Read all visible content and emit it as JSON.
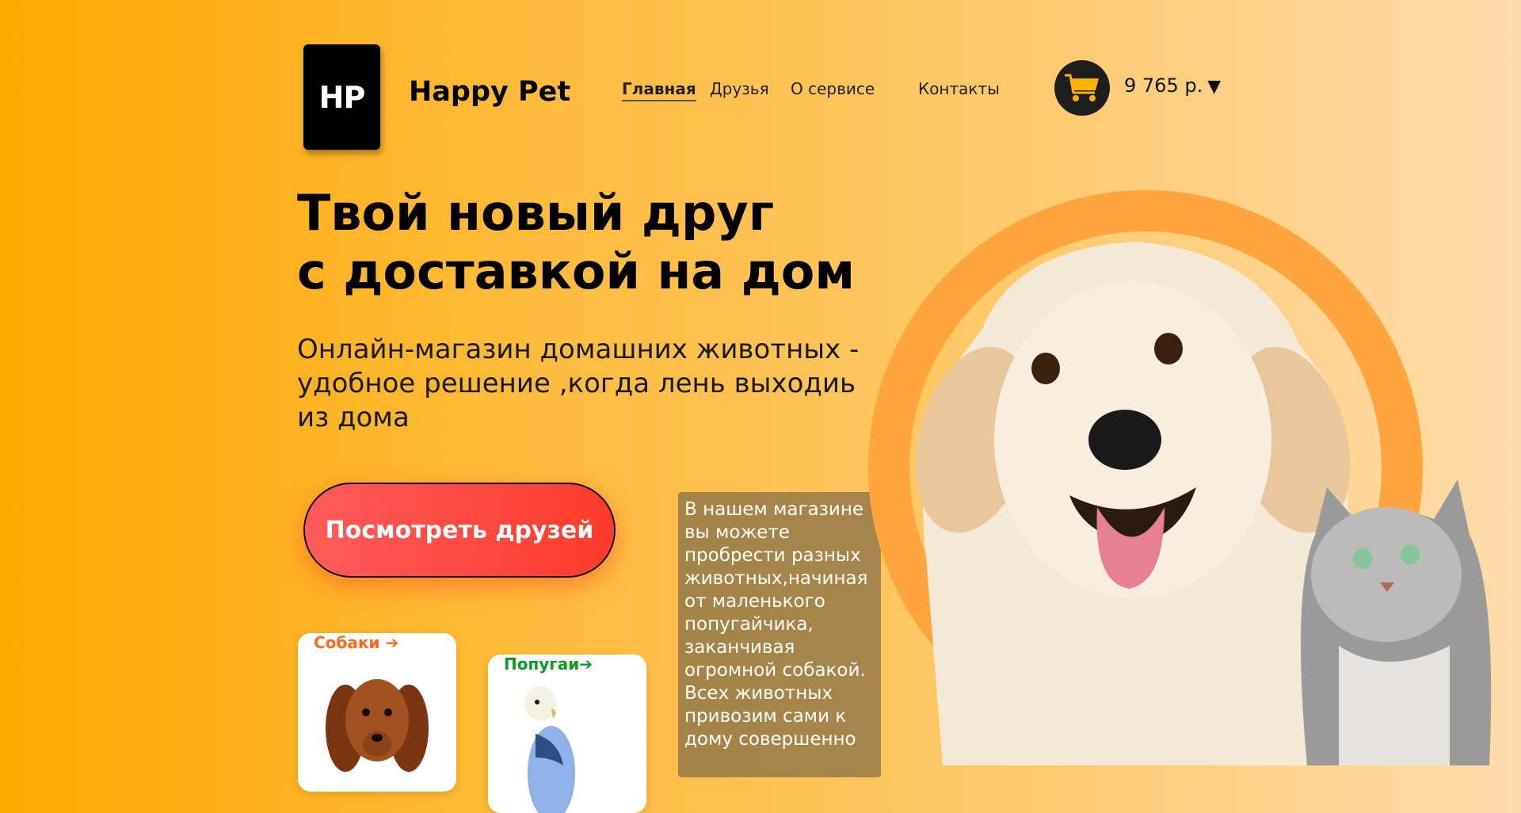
{
  "logo": {
    "text": "HP"
  },
  "brand": {
    "name": "Happy Pet"
  },
  "nav": {
    "items": [
      {
        "label": "Главная",
        "active": true
      },
      {
        "label": "Друзья",
        "active": false
      },
      {
        "label": "О сервисе",
        "active": false
      },
      {
        "label": "Контакты",
        "active": false
      }
    ]
  },
  "cart": {
    "icon": "cart-icon",
    "total": "9 765 р.",
    "caret": "▼"
  },
  "hero": {
    "title_line1": "Твой новый друг",
    "title_line2": "с доставкой на дом",
    "lead": "Онлайн-магазин домашних животных - удобное решение ,когда лень выходиь из дома",
    "cta": "Посмотреть друзей"
  },
  "categories": [
    {
      "label": "Собаки ➔",
      "image": "dachshund-photo",
      "color": "#ff6a1a"
    },
    {
      "label": "Попугаи➔",
      "image": "budgie-photo",
      "color": "#119922"
    }
  ],
  "info": {
    "text": "В нашем магазине вы можете пробрести разных животных,начиная от маленького попугайчика, заканчивая огромной собакой. Всех животных привозим сами к дому совершенно"
  },
  "colors": {
    "accent_orange": "#ffa800",
    "ring": "#ffa53d",
    "cta_red": "#ff3b2a",
    "cart_yellow": "#ffb300"
  }
}
